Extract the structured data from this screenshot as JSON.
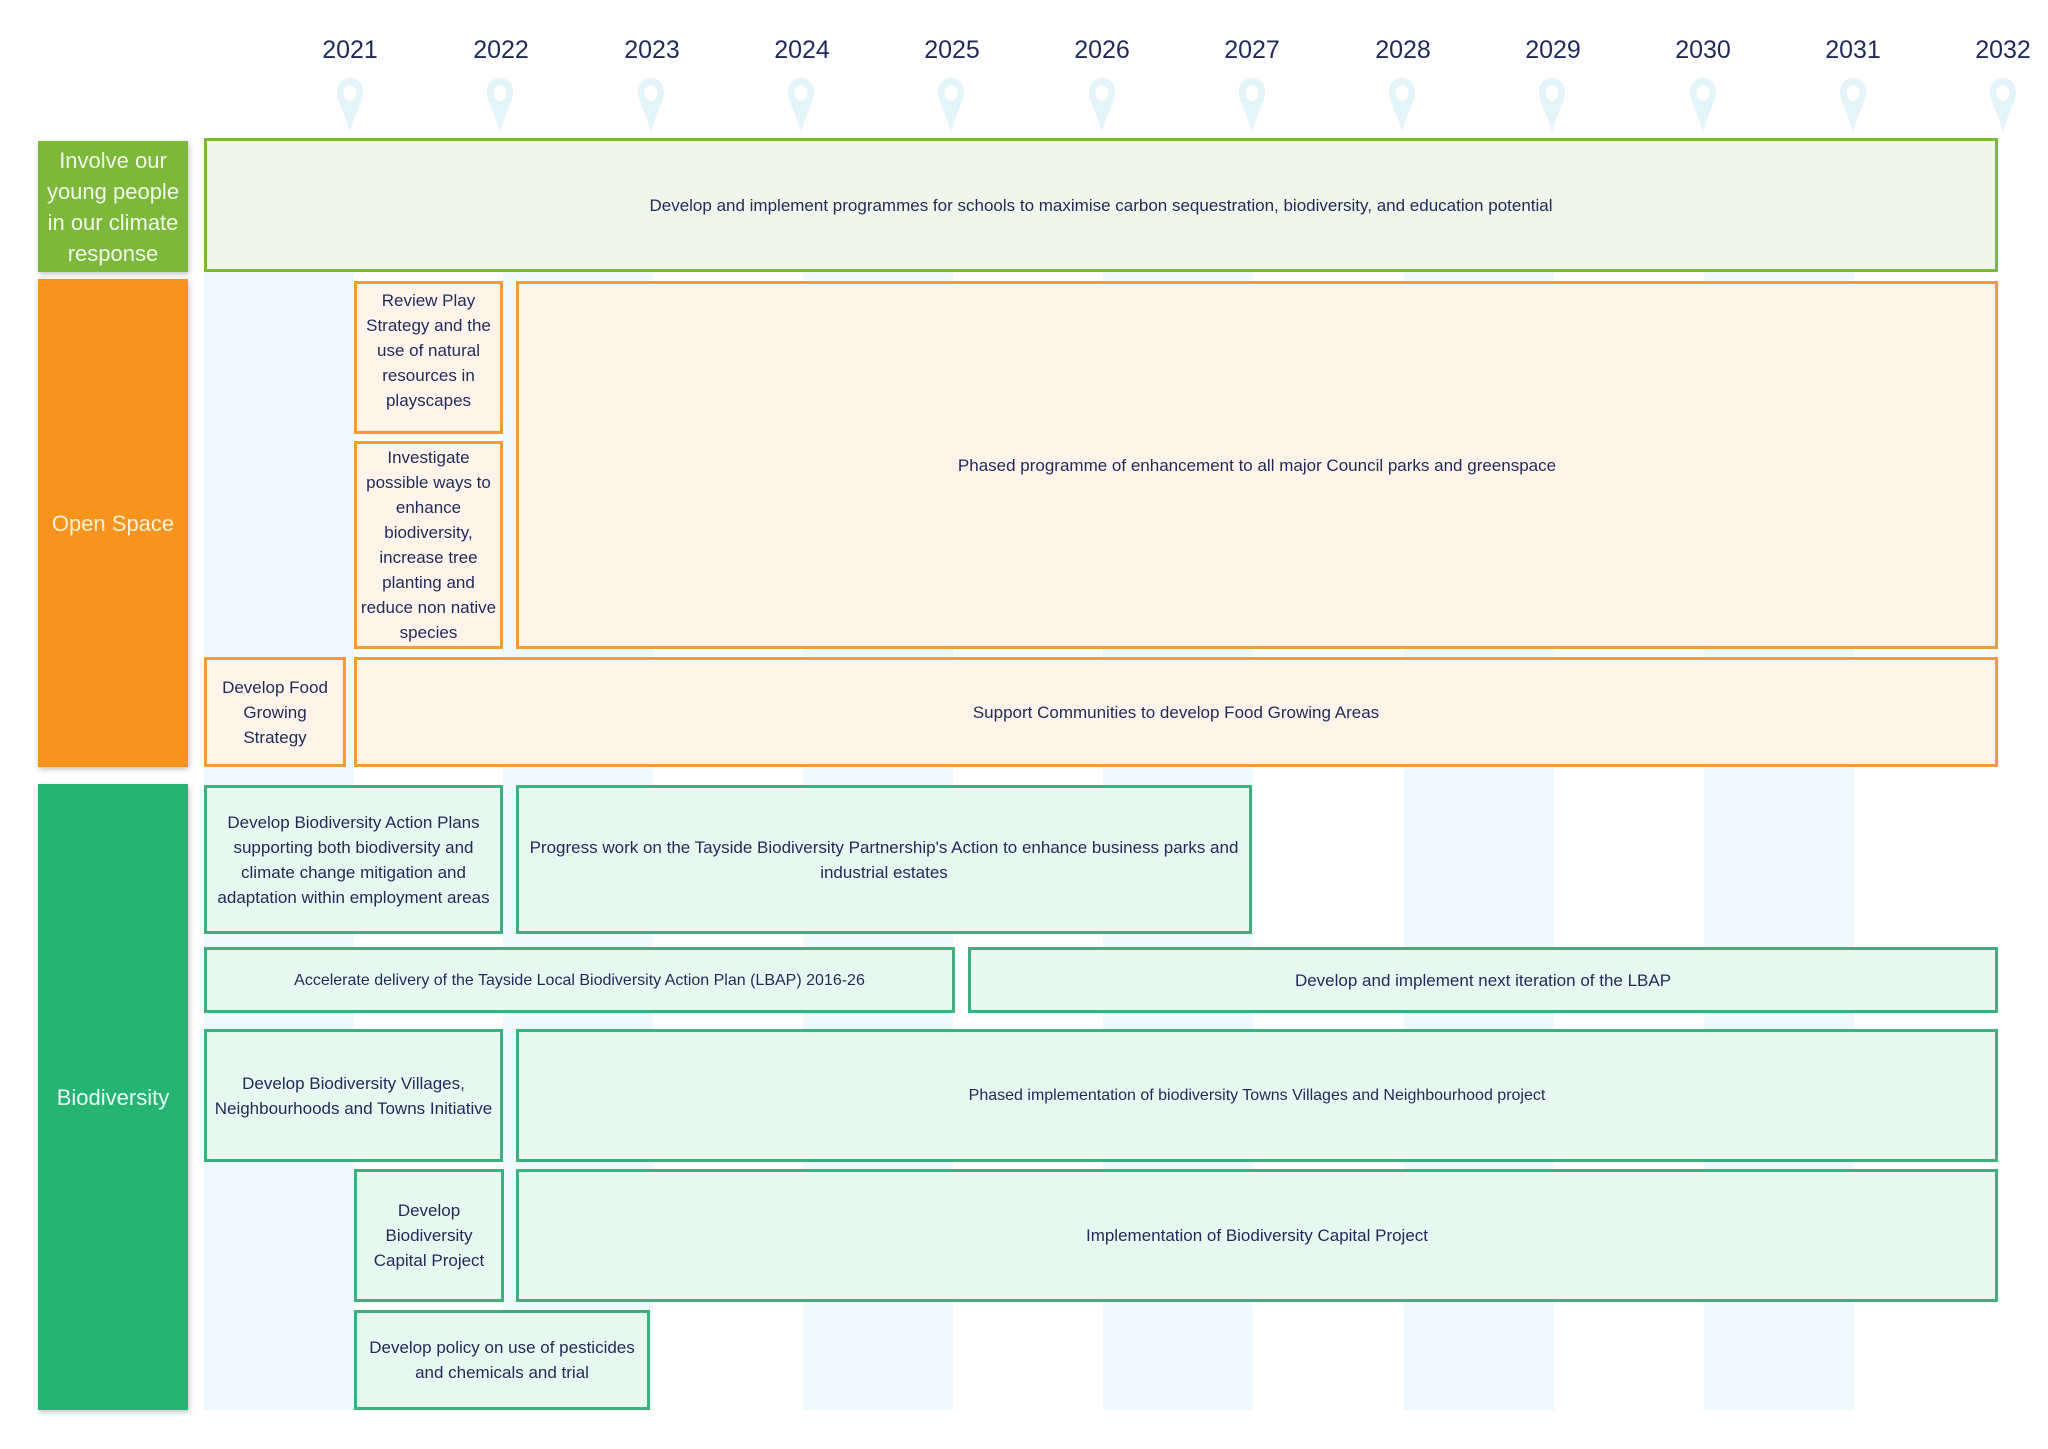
{
  "timeline": {
    "years": [
      "2021",
      "2022",
      "2023",
      "2024",
      "2025",
      "2026",
      "2027",
      "2028",
      "2029",
      "2030",
      "2031",
      "2032"
    ],
    "pin_icon": "map-pin-icon",
    "colors": {
      "stripe": "#edf9fd",
      "pin": "#e3f4fb",
      "text": "#1f2a5c"
    }
  },
  "categories": [
    {
      "id": "young-people",
      "label": "Involve our young people in our climate response",
      "color": "#7cb83a",
      "actions": [
        {
          "text": "Develop and implement programmes for schools to maximise carbon sequestration, biodiversity, and education potential",
          "start": 2020,
          "end": 2032
        }
      ]
    },
    {
      "id": "open-space",
      "label": "Open Space",
      "color": "#f7941d",
      "actions": [
        {
          "text": "Review Play Strategy and the use of natural resources in playscapes",
          "start": 2021,
          "end": 2022
        },
        {
          "text": "Investigate possible ways to enhance biodiversity, increase tree planting and reduce non native species",
          "start": 2021,
          "end": 2022
        },
        {
          "text": "Phased programme of enhancement to all major Council parks and greenspace",
          "start": 2022,
          "end": 2032
        },
        {
          "text": "Develop Food Growing Strategy",
          "start": 2020,
          "end": 2021
        },
        {
          "text": "Support Communities to develop Food Growing Areas",
          "start": 2021,
          "end": 2032
        }
      ]
    },
    {
      "id": "biodiversity",
      "label": "Biodiversity",
      "color": "#25b474",
      "actions": [
        {
          "text": "Develop Biodiversity Action Plans supporting both biodiversity and climate change mitigation and adaptation within employment areas",
          "start": 2020,
          "end": 2022
        },
        {
          "text": "Progress work on the Tayside Biodiversity Partnership's Action to enhance business parks and industrial estates",
          "start": 2022,
          "end": 2027
        },
        {
          "text": "Accelerate delivery of the Tayside Local Biodiversity Action Plan (LBAP)  2016-26",
          "start": 2020,
          "end": 2025
        },
        {
          "text": "Develop and implement next iteration of the LBAP",
          "start": 2025,
          "end": 2032
        },
        {
          "text": "Develop Biodiversity Villages, Neighbourhoods and Towns Initiative",
          "start": 2020,
          "end": 2022
        },
        {
          "text": "Phased implementation of biodiversity Towns Villages and Neighbourhood project",
          "start": 2022,
          "end": 2032
        },
        {
          "text": "Develop Biodiversity Capital Project",
          "start": 2021,
          "end": 2022
        },
        {
          "text": "Implementation of Biodiversity Capital Project",
          "start": 2022,
          "end": 2032
        },
        {
          "text": "Develop policy on use of pesticides and chemicals and trial",
          "start": 2021,
          "end": 2023
        }
      ]
    }
  ]
}
